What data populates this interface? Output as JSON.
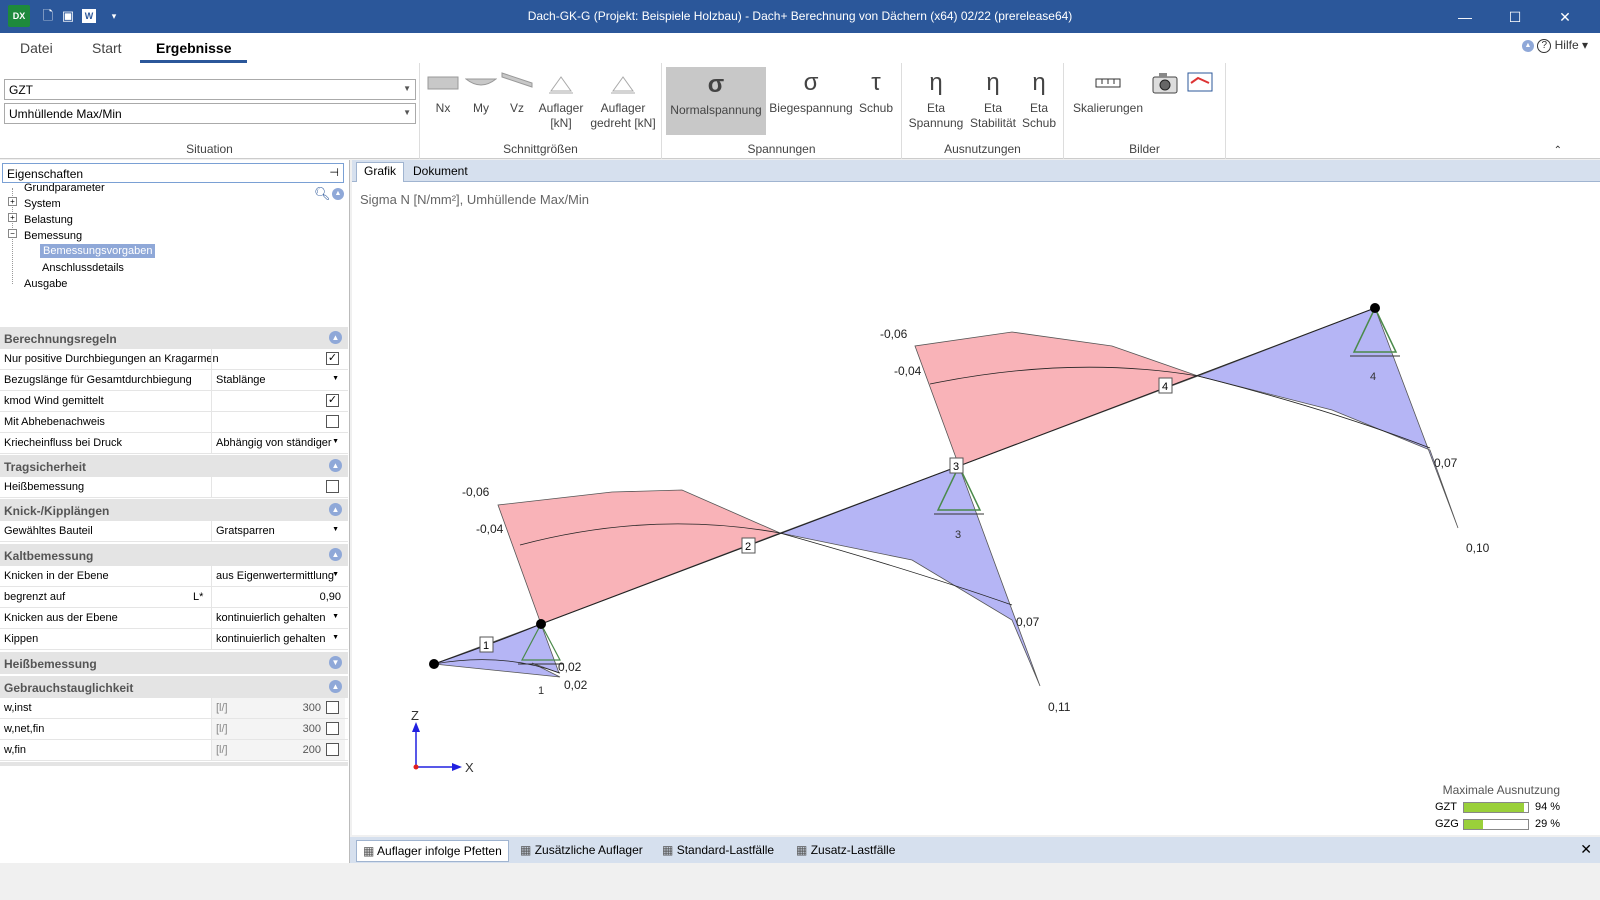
{
  "window": {
    "title": "Dach-GK-G (Projekt: Beispiele Holzbau) - Dach+ Berechnung von Dächern (x64) 02/22 (prerelease64)",
    "app_icon": "DX"
  },
  "menu": {
    "tabs": [
      "Datei",
      "Start",
      "Ergebnisse"
    ],
    "active": "Ergebnisse",
    "help": "Hilfe"
  },
  "ribbon": {
    "situation": {
      "combo1": "GZT",
      "combo2": "Umhüllende Max/Min",
      "label": "Situation"
    },
    "schnittgroessen": {
      "label": "Schnittgrößen",
      "buttons": [
        "Nx",
        "My",
        "Vz",
        "Auflager",
        "[kN]",
        "Auflager",
        "gedreht [kN]"
      ]
    },
    "spannungen": {
      "label": "Spannungen",
      "buttons": [
        "Normalspannung",
        "Biegespannung",
        "Schub"
      ],
      "symbols": [
        "σ",
        "σ",
        "τ"
      ]
    },
    "ausnutzungen": {
      "label": "Ausnutzungen",
      "buttons": [
        [
          "Eta",
          "Spannung"
        ],
        [
          "Eta",
          "Stabilität"
        ],
        [
          "Eta",
          "Schub"
        ]
      ],
      "symbol": "η"
    },
    "bilder": {
      "label": "Bilder",
      "buttons": [
        "Skalierungen"
      ]
    }
  },
  "properties": {
    "header": "Eigenschaften",
    "tree": [
      "Grundparameter",
      "System",
      "Belastung",
      "Bemessung",
      "Bemessungsvorgaben",
      "Anschlussdetails",
      "Ausgabe"
    ],
    "sections": {
      "berechnungsregeln": "Berechnungsregeln",
      "tragsicherheit": "Tragsicherheit",
      "knick": "Knick-/Kipplängen",
      "kalt": "Kaltbemessung",
      "heiss": "Heißbemessung",
      "gebrauch": "Gebrauchstauglichkeit"
    },
    "rows": {
      "r1": {
        "label": "Nur positive Durchbiegungen an Kragarmen",
        "checked": "✓"
      },
      "r2": {
        "label": "Bezugslänge für Gesamtdurchbiegung",
        "value": "Stablänge"
      },
      "r3": {
        "label": "kmod Wind gemittelt",
        "checked": "✓"
      },
      "r4": {
        "label": "Mit Abhebenachweis",
        "checked": ""
      },
      "r5": {
        "label": "Kriecheinfluss bei Druck",
        "value": "Abhängig von ständiger"
      },
      "r6": {
        "label": "Heißbemessung",
        "checked": ""
      },
      "r7": {
        "label": "Gewähltes Bauteil",
        "value": "Gratsparren"
      },
      "r8": {
        "label": "Knicken in der Ebene",
        "value": "aus Eigenwertermittlung"
      },
      "r9": {
        "label": "begrenzt auf",
        "unit": "L*",
        "value": "0,90"
      },
      "r10": {
        "label": "Knicken aus der Ebene",
        "value": "kontinuierlich gehalten"
      },
      "r11": {
        "label": "Kippen",
        "value": "kontinuierlich gehalten"
      },
      "w1": {
        "label": "w,inst",
        "unit": "[l/]",
        "value": "300"
      },
      "w2": {
        "label": "w,net,fin",
        "unit": "[l/]",
        "value": "300"
      },
      "w3": {
        "label": "w,fin",
        "unit": "[l/]",
        "value": "200"
      }
    }
  },
  "graphic": {
    "tabs": [
      "Grafik",
      "Dokument"
    ],
    "caption": "Sigma N [N/mm²], Umhüllende Max/Min",
    "labels": [
      "-0,06",
      "-0,04",
      "-0,06",
      "-0,04",
      "0,07",
      "0,10",
      "0,07",
      "0,11",
      "0,02",
      "0,02"
    ],
    "nodes": [
      "1",
      "2",
      "3",
      "4"
    ],
    "supports": [
      "1",
      "3",
      "4"
    ],
    "axes": {
      "z": "Z",
      "x": "X"
    },
    "utilization": {
      "title": "Maximale Ausnutzung",
      "rows": [
        {
          "name": "GZT",
          "percent": 94,
          "text": "94 %"
        },
        {
          "name": "GZG",
          "percent": 29,
          "text": "29 %"
        }
      ]
    },
    "colors": {
      "compression": "#f9b3b8",
      "tension": "#b5b5f5"
    }
  },
  "bottom_tabs": [
    "Auflager infolge Pfetten",
    "Zusätzliche Auflager",
    "Standard-Lastfälle",
    "Zusatz-Lastfälle"
  ]
}
